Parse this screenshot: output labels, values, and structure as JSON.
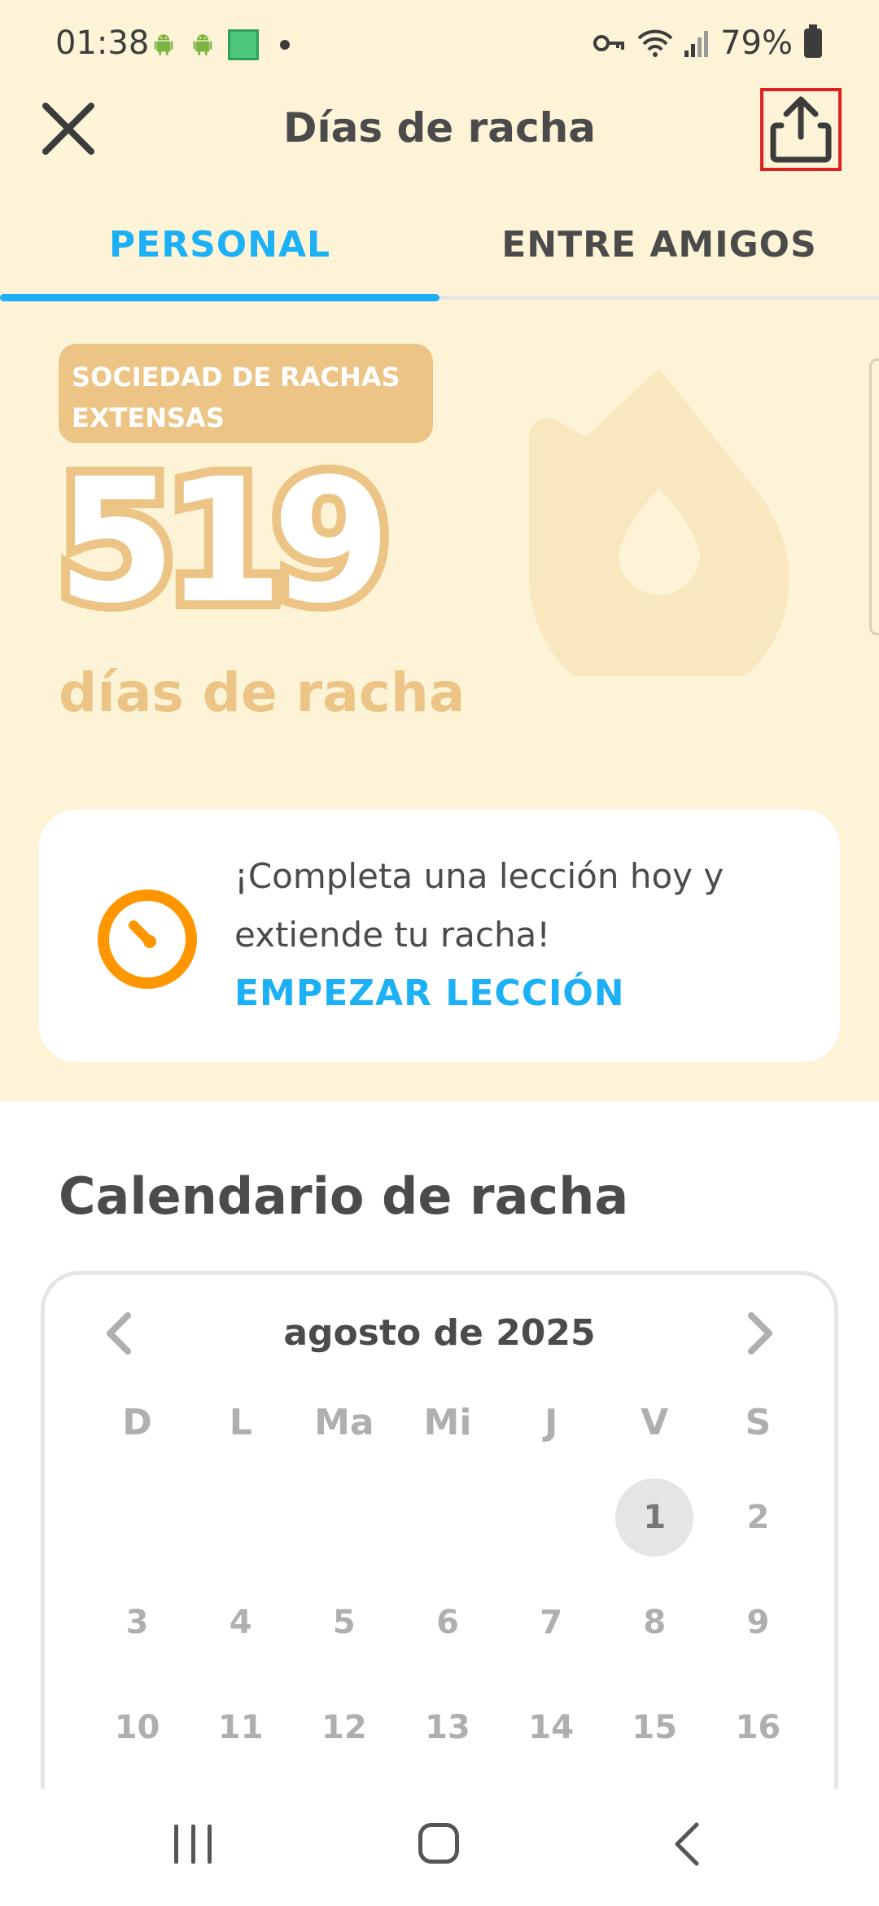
{
  "status_bar": {
    "time": "01:38",
    "battery": "79%",
    "icons": [
      "android-icon",
      "android-icon",
      "app-icon",
      "dot-icon",
      "key-icon",
      "wifi-icon",
      "signal-icon",
      "battery-icon"
    ]
  },
  "header": {
    "title": "Días de racha",
    "close_icon": "close-icon",
    "share_icon": "share-icon"
  },
  "tabs": [
    {
      "label": "PERSONAL",
      "active": true
    },
    {
      "label": "ENTRE AMIGOS",
      "active": false
    }
  ],
  "streak": {
    "badge": "SOCIEDAD DE RACHAS EXTENSAS",
    "count": "519",
    "label": "días de racha",
    "flame_icon": "flame-icon"
  },
  "lesson_card": {
    "message": "¡Completa una lección hoy y extiende tu racha!",
    "cta": "EMPEZAR LECCIÓN",
    "icon": "timer-icon"
  },
  "calendar": {
    "heading": "Calendario de racha",
    "month": "agosto de 2025",
    "weekdays": [
      "D",
      "L",
      "Ma",
      "Mi",
      "J",
      "V",
      "S"
    ],
    "leading_blanks": 5,
    "days": [
      "1",
      "2",
      "3",
      "4",
      "5",
      "6",
      "7",
      "8",
      "9",
      "10",
      "11",
      "12",
      "13",
      "14",
      "15",
      "16"
    ],
    "today": "1"
  },
  "colors": {
    "accent_blue": "#1cb0f6",
    "streak_gold": "#ecc586",
    "background_cream": "#fdf4d8",
    "timer_orange": "#ff9600",
    "highlight_red": "#e02020"
  }
}
